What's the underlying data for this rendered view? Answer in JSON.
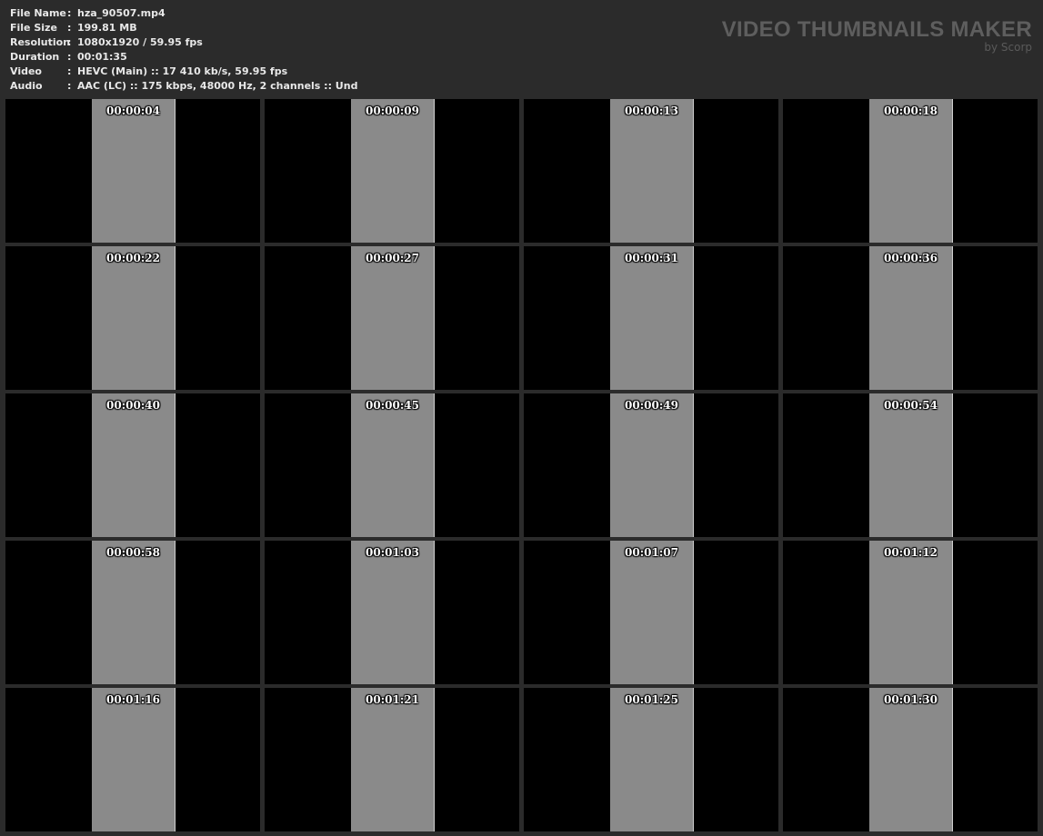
{
  "info": {
    "rows": [
      {
        "label": "File Name",
        "value": "hza_90507.mp4"
      },
      {
        "label": "File Size",
        "value": "199.81 MB"
      },
      {
        "label": "Resolution",
        "value": "1080x1920 / 59.95 fps"
      },
      {
        "label": "Duration",
        "value": "00:01:35"
      },
      {
        "label": "Video",
        "value": "HEVC (Main) :: 17 410 kb/s, 59.95 fps"
      },
      {
        "label": "Audio",
        "value": "AAC (LC) :: 175 kbps, 48000 Hz, 2 channels :: Und"
      }
    ],
    "separator": ":"
  },
  "watermark": {
    "title": "VIDEO THUMBNAILS MAKER",
    "subtitle": "by Scorp"
  },
  "thumbnails": [
    "00:00:04",
    "00:00:09",
    "00:00:13",
    "00:00:18",
    "00:00:22",
    "00:00:27",
    "00:00:31",
    "00:00:36",
    "00:00:40",
    "00:00:45",
    "00:00:49",
    "00:00:54",
    "00:00:58",
    "00:01:03",
    "00:01:07",
    "00:01:12",
    "00:01:16",
    "00:01:21",
    "00:01:25",
    "00:01:30"
  ]
}
